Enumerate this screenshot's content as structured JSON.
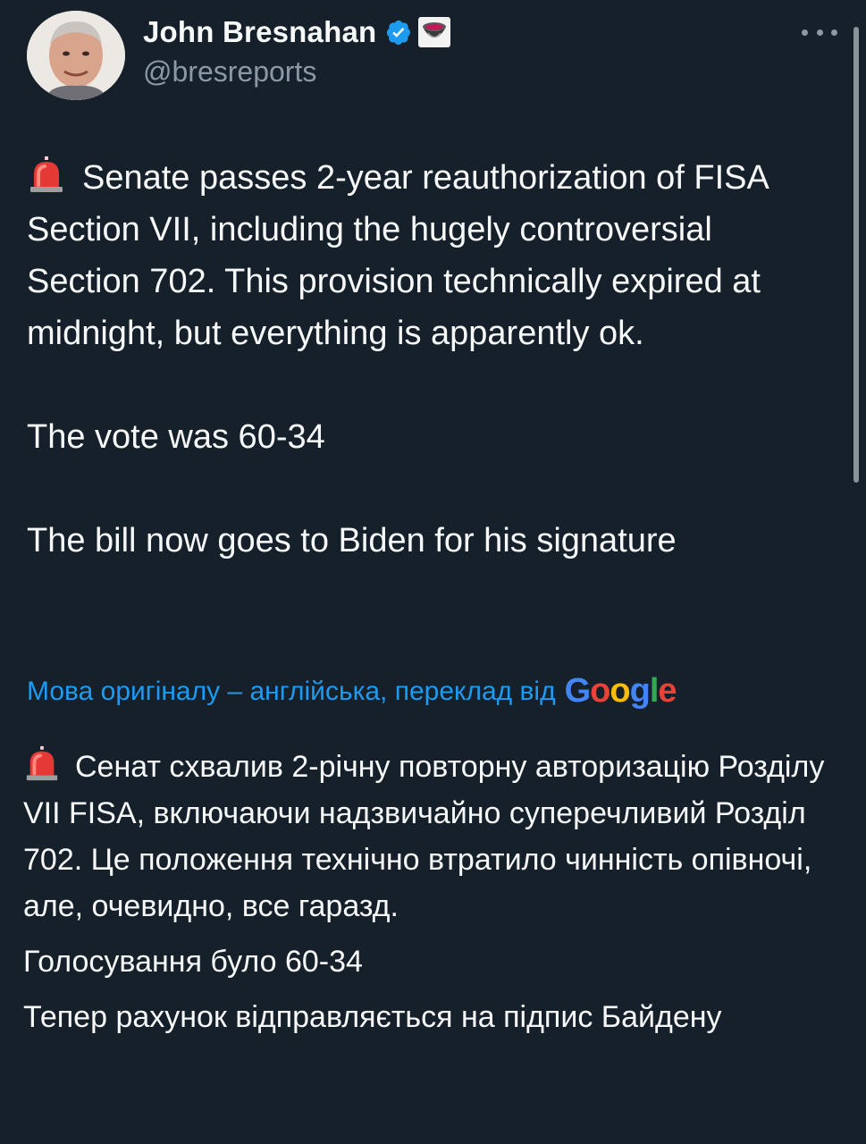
{
  "author": {
    "display_name": "John Bresnahan",
    "handle": "@bresreports",
    "verified": true,
    "verified_color": "#1d9bf0"
  },
  "more_button": {
    "icon": "more-horizontal-icon"
  },
  "tweet": {
    "paragraph_1": "Senate passes 2-year reauthorization of FISA Section VII, including the hugely controversial Section 702. This provision technically expired at midnight, but everything is apparently ok.",
    "paragraph_2": "The vote was 60-34",
    "paragraph_3": "The bill now goes to Biden for his signature",
    "emoji": "rotating-light-icon"
  },
  "translation": {
    "notice": "Мова оригіналу – англійська, переклад від",
    "provider": "Google",
    "paragraph_1": "Сенат схвалив 2-річну повторну авторизацію Розділу VII FISA, включаючи надзвичайно суперечливий Розділ 702. Це положення технічно втратило чинність опівночі, але, очевидно, все гаразд.",
    "paragraph_2": "Голосування було 60-34",
    "paragraph_3": "Тепер рахунок відправляється на підпис Байдену"
  },
  "colors": {
    "background": "#15202b",
    "text": "#f7f9f9",
    "secondary_text": "#8b98a5",
    "link": "#1d9bf0"
  }
}
